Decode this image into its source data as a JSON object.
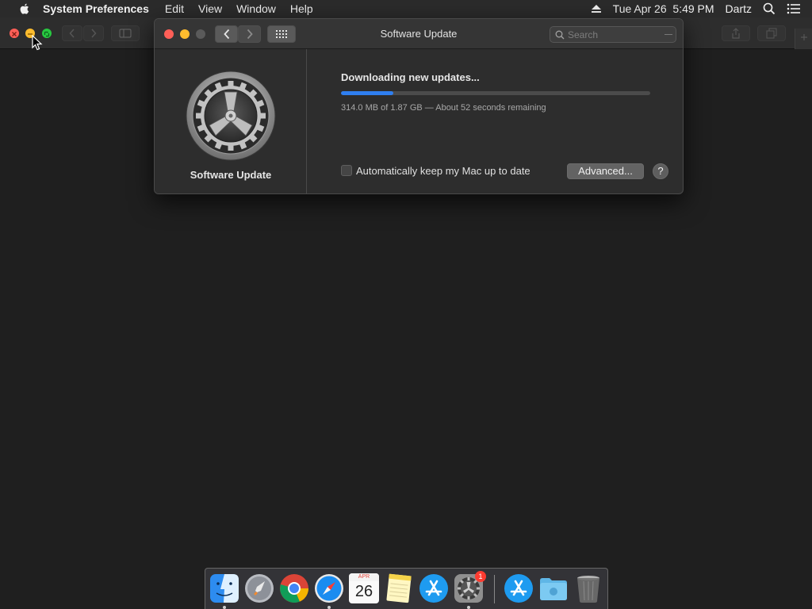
{
  "menubar": {
    "app_name": "System Preferences",
    "menus": [
      "Edit",
      "View",
      "Window",
      "Help"
    ],
    "datetime": "Tue Apr 26  5:49 PM",
    "user": "Dartz"
  },
  "window": {
    "title": "Software Update",
    "search_placeholder": "Search"
  },
  "pane": {
    "icon_label": "Software Update",
    "status": "Downloading new updates...",
    "progress": 0.168,
    "progress_detail": "314.0 MB of 1.87 GB — About 52 seconds remaining",
    "auto_update_label": "Automatically keep my Mac up to date",
    "auto_update_checked": false,
    "advanced_button": "Advanced...",
    "help_button": "?"
  },
  "dock": {
    "items": [
      "finder",
      "launchpad",
      "chrome",
      "safari",
      "calendar",
      "notes",
      "app-store",
      "system-preferences",
      "app-store-downloads",
      "downloads-folder",
      "trash"
    ],
    "calendar_month": "APR",
    "calendar_day": "26",
    "system_preferences_badge": "1"
  },
  "colors": {
    "accent": "#2f7ff0",
    "close": "#ff5f57",
    "minimize": "#febc2e",
    "zoom": "#28c840"
  }
}
